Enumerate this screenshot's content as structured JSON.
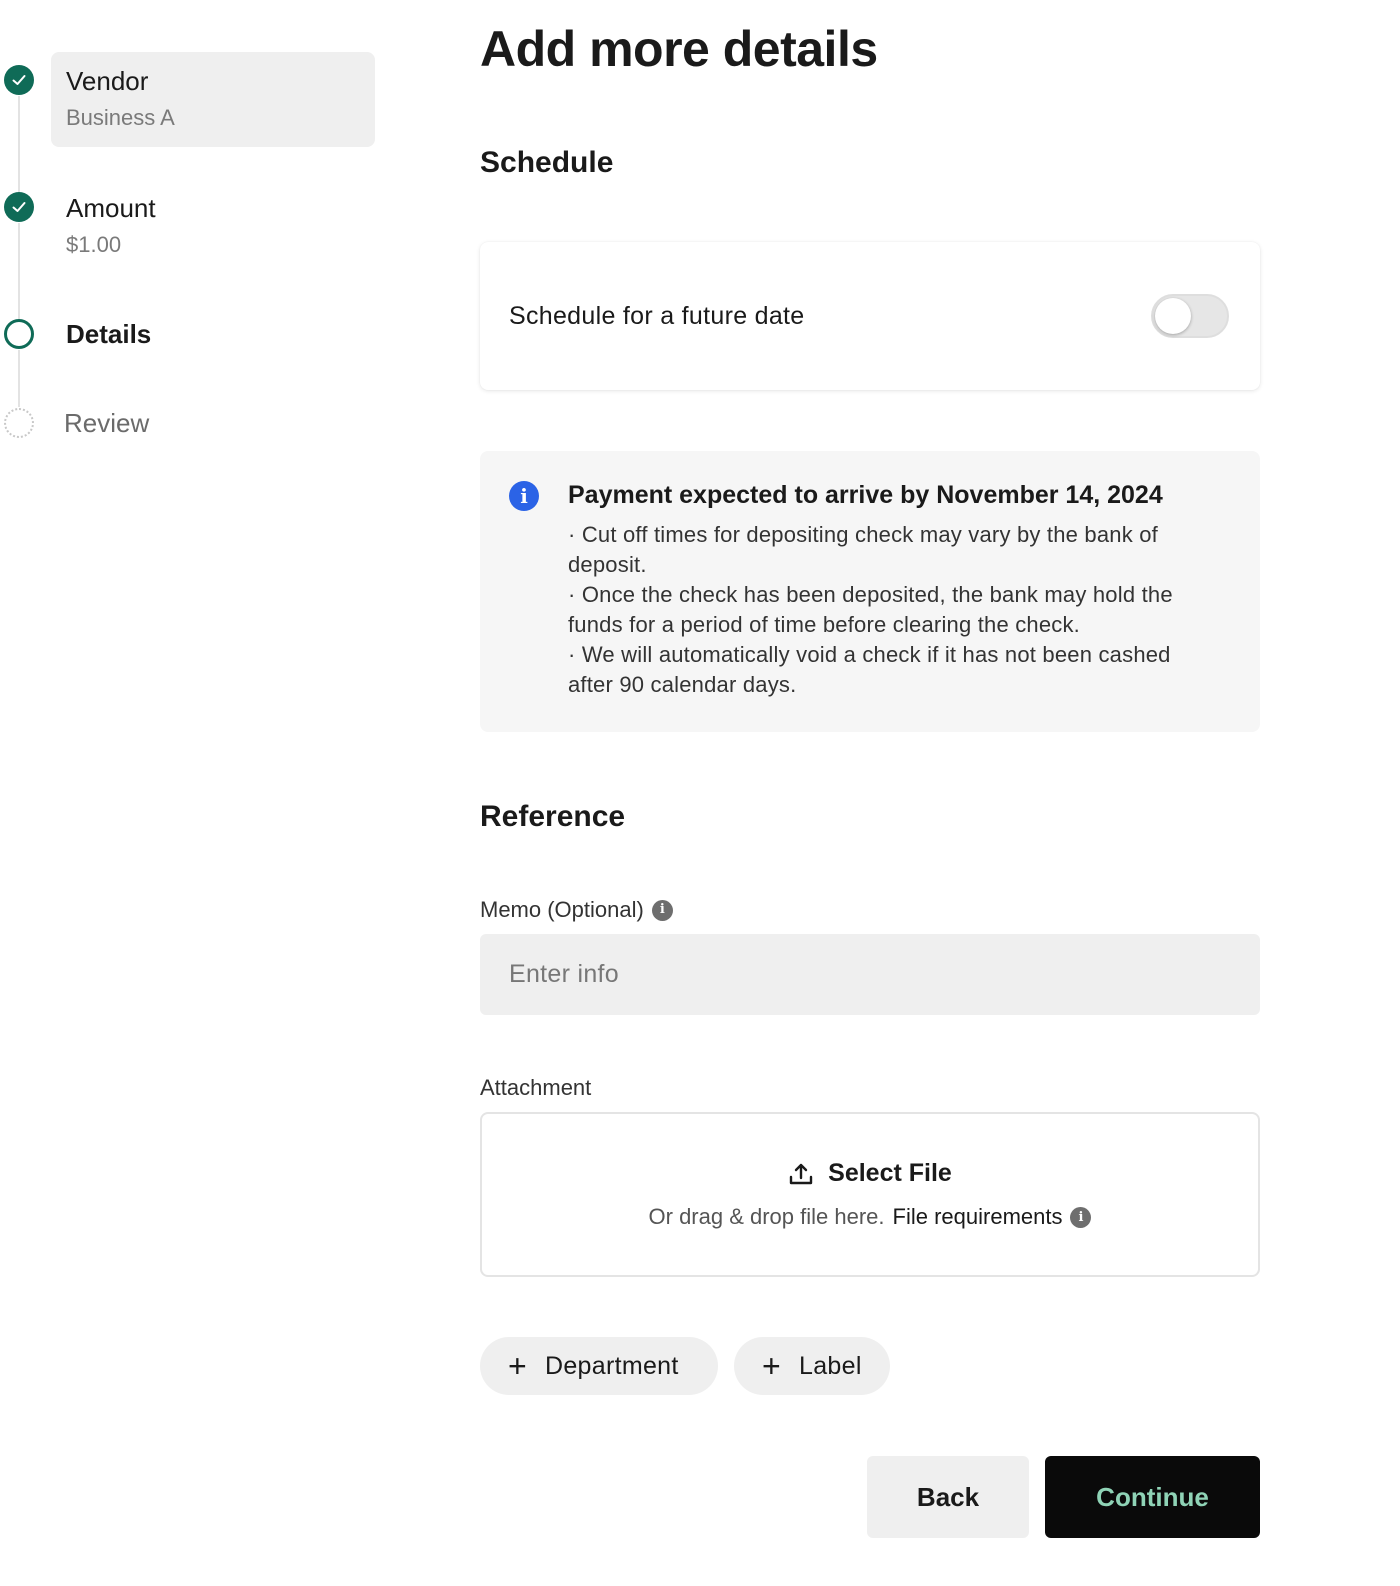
{
  "stepper": {
    "steps": [
      {
        "title": "Vendor",
        "subtitle": "Business A",
        "status": "done"
      },
      {
        "title": "Amount",
        "subtitle": "$1.00",
        "status": "done"
      },
      {
        "title": "Details",
        "subtitle": "",
        "status": "current"
      },
      {
        "title": "Review",
        "subtitle": "",
        "status": "pending"
      }
    ]
  },
  "main": {
    "title": "Add more details",
    "schedule": {
      "heading": "Schedule",
      "toggle_label": "Schedule for a future date",
      "toggle_on": false
    },
    "info": {
      "icon": "info-icon",
      "title": "Payment expected to arrive by November 14, 2024",
      "lines": [
        "· Cut off times for depositing check may vary by the bank of deposit.",
        "· Once the check has been deposited, the bank may hold the funds for a period of time before clearing the check.",
        "· We will automatically void a check if it has not been cashed after 90 calendar days."
      ]
    },
    "reference": {
      "heading": "Reference",
      "memo_label": "Memo (Optional)",
      "memo_placeholder": "Enter info",
      "memo_value": "",
      "attachment_label": "Attachment",
      "select_file": "Select File",
      "drop_text": "Or drag & drop file here.",
      "file_requirements": "File requirements"
    },
    "chips": [
      {
        "label": "Department"
      },
      {
        "label": "Label"
      }
    ],
    "actions": {
      "back": "Back",
      "continue": "Continue"
    }
  },
  "colors": {
    "accent_green": "#0f6b57",
    "info_blue": "#2b63e6",
    "continue_text": "#8fd3b6"
  }
}
